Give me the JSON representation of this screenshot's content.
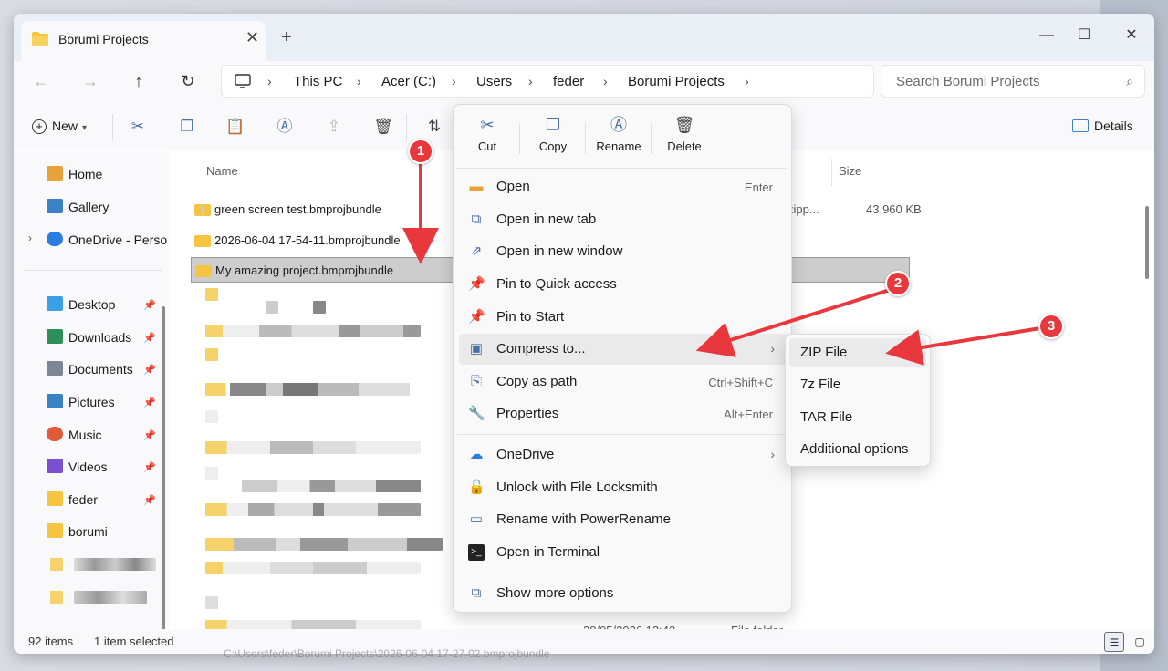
{
  "window": {
    "tab_title": "Borumi Projects",
    "close_glyph": "✕",
    "add_glyph": "+",
    "minimize_glyph": "—",
    "maximize_glyph": "☐",
    "window_close_glyph": "✕"
  },
  "address": {
    "crumbs": [
      "This PC",
      "Acer (C:)",
      "Users",
      "feder",
      "Borumi Projects"
    ],
    "search_placeholder": "Search Borumi Projects"
  },
  "toolbar": {
    "new_label": "New",
    "details_label": "Details"
  },
  "sidebar": {
    "items": [
      {
        "label": "Home",
        "icon": "home-icon",
        "color": "#e8a23a"
      },
      {
        "label": "Gallery",
        "icon": "gallery-icon",
        "color": "#3b82c4"
      },
      {
        "label": "OneDrive - Perso",
        "icon": "onedrive-icon",
        "color": "#2a7de1"
      },
      {
        "label": "Desktop",
        "icon": "desktop-icon",
        "color": "#3aa0e8"
      },
      {
        "label": "Downloads",
        "icon": "downloads-icon",
        "color": "#2f8f5b"
      },
      {
        "label": "Documents",
        "icon": "documents-icon",
        "color": "#7b8794"
      },
      {
        "label": "Pictures",
        "icon": "pictures-icon",
        "color": "#3b82c4"
      },
      {
        "label": "Music",
        "icon": "music-icon",
        "color": "#e25a3a"
      },
      {
        "label": "Videos",
        "icon": "videos-icon",
        "color": "#7a4fd0"
      },
      {
        "label": "feder",
        "icon": "folder-icon",
        "color": "#f5c542"
      },
      {
        "label": "borumi",
        "icon": "folder-icon",
        "color": "#f5c542"
      }
    ]
  },
  "filelist": {
    "columns": {
      "name": "Name",
      "size": "Size"
    },
    "rows": [
      {
        "name": "green screen test.bmprojbundle",
        "type": "zipp...",
        "size": "43,960 KB"
      },
      {
        "name": "2026-06-04 17-54-11.bmprojbundle",
        "type": "",
        "size": ""
      },
      {
        "name": "My amazing project.bmprojbundle",
        "type": "",
        "size": ""
      }
    ],
    "bottom_row": {
      "date": "28/05/2026 12:42",
      "type": "File folder"
    }
  },
  "status": {
    "count": "92 items",
    "selected": "1 item selected"
  },
  "path_hint": "C:\\Users\\feder\\Borumi Projects\\2026-06-04 17-27-02.bmprojbundle",
  "context_menu": {
    "quick": [
      {
        "label": "Cut",
        "icon": "cut-icon"
      },
      {
        "label": "Copy",
        "icon": "copy-icon"
      },
      {
        "label": "Rename",
        "icon": "rename-icon"
      },
      {
        "label": "Delete",
        "icon": "delete-icon"
      }
    ],
    "items": [
      {
        "label": "Open",
        "shortcut": "Enter",
        "icon": "folder-open-icon"
      },
      {
        "label": "Open in new tab",
        "shortcut": "",
        "icon": "new-tab-icon"
      },
      {
        "label": "Open in new window",
        "shortcut": "",
        "icon": "new-window-icon"
      },
      {
        "label": "Pin to Quick access",
        "shortcut": "",
        "icon": "pin-icon"
      },
      {
        "label": "Pin to Start",
        "shortcut": "",
        "icon": "pin-start-icon"
      },
      {
        "label": "Compress to...",
        "shortcut": "",
        "icon": "compress-icon"
      },
      {
        "label": "Copy as path",
        "shortcut": "Ctrl+Shift+C",
        "icon": "copy-path-icon"
      },
      {
        "label": "Properties",
        "shortcut": "Alt+Enter",
        "icon": "properties-icon"
      },
      {
        "label": "OneDrive",
        "shortcut": "",
        "icon": "onedrive-icon"
      },
      {
        "label": "Unlock with File Locksmith",
        "shortcut": "",
        "icon": "lock-icon"
      },
      {
        "label": "Rename with PowerRename",
        "shortcut": "",
        "icon": "powerrename-icon"
      },
      {
        "label": "Open in Terminal",
        "shortcut": "",
        "icon": "terminal-icon"
      },
      {
        "label": "Show more options",
        "shortcut": "",
        "icon": "more-options-icon"
      }
    ]
  },
  "submenu": {
    "items": [
      "ZIP File",
      "7z File",
      "TAR File",
      "Additional options"
    ]
  },
  "annotations": {
    "badges": [
      "1",
      "2",
      "3"
    ],
    "color": "#e8383d"
  }
}
